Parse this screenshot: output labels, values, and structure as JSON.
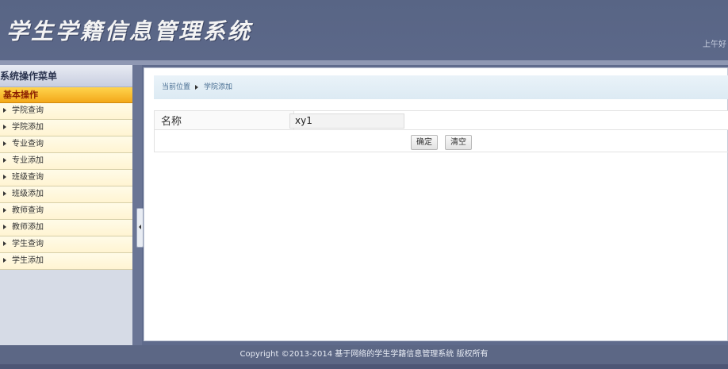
{
  "header": {
    "app_title": "学生学籍信息管理系统",
    "greeting": "上午好"
  },
  "sidebar": {
    "title": "系统操作菜单",
    "group_label": "基本操作",
    "items": [
      {
        "label": "学院查询"
      },
      {
        "label": "学院添加"
      },
      {
        "label": "专业查询"
      },
      {
        "label": "专业添加"
      },
      {
        "label": "班级查询"
      },
      {
        "label": "班级添加"
      },
      {
        "label": "教师查询"
      },
      {
        "label": "教师添加"
      },
      {
        "label": "学生查询"
      },
      {
        "label": "学生添加"
      }
    ]
  },
  "breadcrumb": {
    "prefix": "当前位置",
    "current": "学院添加"
  },
  "form": {
    "name_label": "名称",
    "name_value": "xy1",
    "confirm_label": "确定",
    "clear_label": "清空"
  },
  "footer": {
    "copyright": "Copyright ©2013-2014 基于网络的学生学籍信息管理系统 版权所有"
  },
  "colors": {
    "header_bg": "#5c6889",
    "menu_group_bg": "#f3a81a",
    "breadcrumb_bg": "#dceaf3"
  }
}
